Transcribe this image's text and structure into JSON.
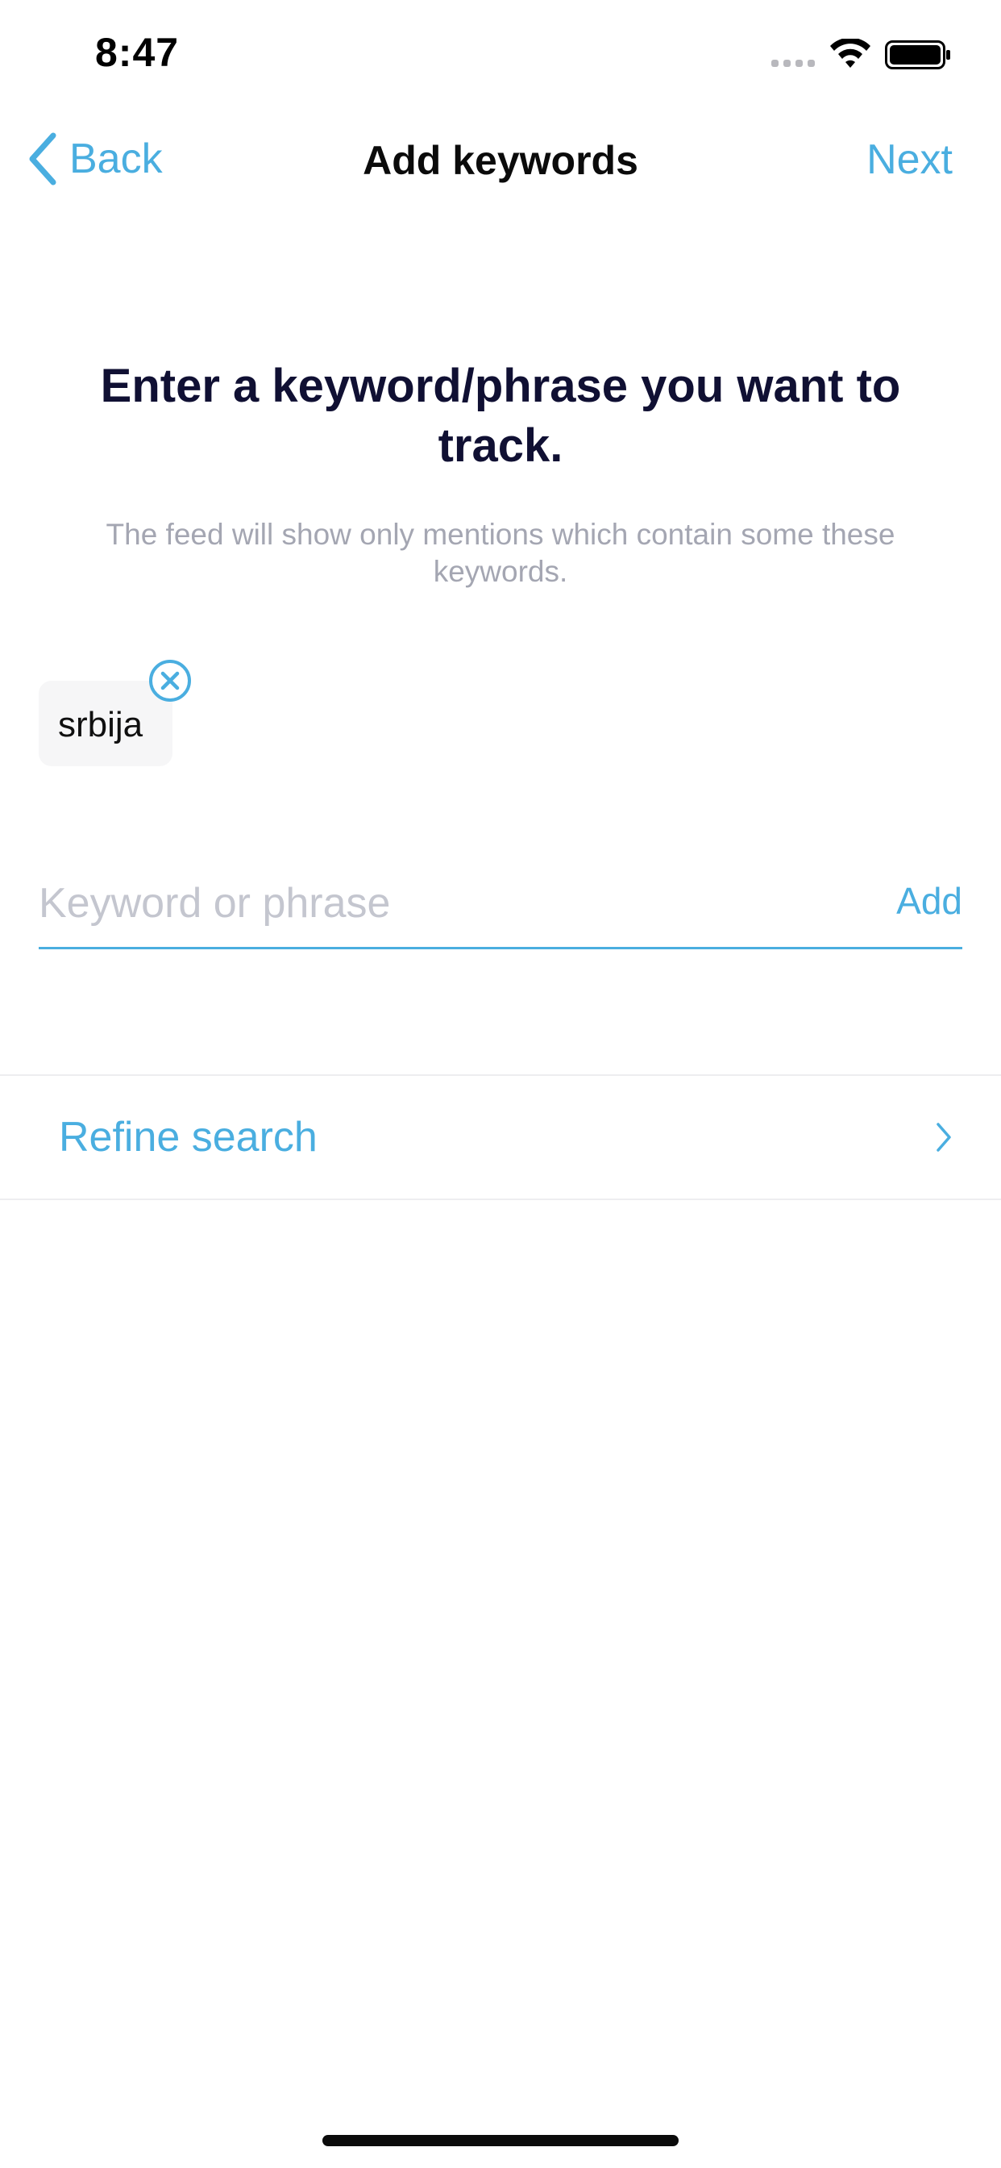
{
  "status_bar": {
    "time": "8:47",
    "icons": [
      "signal-dots-icon",
      "wifi-icon",
      "battery-icon"
    ]
  },
  "nav": {
    "back_label": "Back",
    "title": "Add keywords",
    "next_label": "Next"
  },
  "intro": {
    "heading": "Enter a keyword/phrase you want to track.",
    "subheading": "The feed will show only mentions which contain some these keywords."
  },
  "keywords": [
    {
      "label": "srbija",
      "remove_icon": "close-circle-icon"
    }
  ],
  "keyword_input": {
    "value": "",
    "placeholder": "Keyword or phrase",
    "add_label": "Add"
  },
  "refine": {
    "label": "Refine search",
    "icon": "chevron-right-icon"
  },
  "colors": {
    "accent": "#4aaee0",
    "heading": "#101033",
    "muted": "#a4a6b2",
    "placeholder": "#c4c6cf",
    "chip_bg": "#f6f6f7",
    "divider": "#ededf0"
  }
}
